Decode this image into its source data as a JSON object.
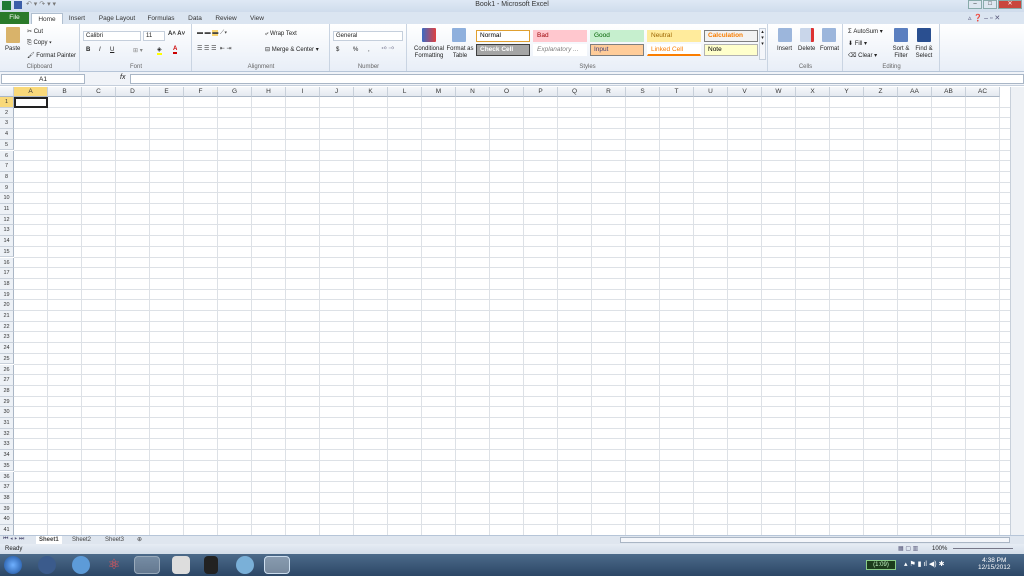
{
  "window": {
    "title": "Book1 - Microsoft Excel"
  },
  "tabs": [
    "File",
    "Home",
    "Insert",
    "Page Layout",
    "Formulas",
    "Data",
    "Review",
    "View"
  ],
  "clipboard": {
    "paste": "Paste",
    "cut": "Cut",
    "copy": "Copy",
    "format_painter": "Format Painter",
    "label": "Clipboard"
  },
  "font": {
    "name": "Calibri",
    "size": "11",
    "bold": "B",
    "italic": "I",
    "underline": "U",
    "label": "Font"
  },
  "alignment": {
    "wrap": "Wrap Text",
    "merge": "Merge & Center",
    "label": "Alignment"
  },
  "number": {
    "format": "General",
    "currency": "$",
    "percent": "%",
    "comma": ",",
    "label": "Number"
  },
  "styles": {
    "conditional": "Conditional Formatting",
    "format_table": "Format as Table",
    "label": "Styles",
    "cells": [
      {
        "name": "Normal",
        "bg": "#ffffff",
        "fg": "#000000",
        "border": "#e0a030"
      },
      {
        "name": "Bad",
        "bg": "#ffc7ce",
        "fg": "#9c0006",
        "border": "#ffc7ce"
      },
      {
        "name": "Good",
        "bg": "#c6efce",
        "fg": "#006100",
        "border": "#c6efce"
      },
      {
        "name": "Neutral",
        "bg": "#ffeb9c",
        "fg": "#9c6500",
        "border": "#ffeb9c"
      },
      {
        "name": "Calculation",
        "bg": "#f2f2f2",
        "fg": "#fa7d00",
        "border": "#7f7f7f"
      },
      {
        "name": "Check Cell",
        "bg": "#a5a5a5",
        "fg": "#ffffff",
        "border": "#3f3f3f"
      },
      {
        "name": "Explanatory ...",
        "bg": "#ffffff",
        "fg": "#7f7f7f",
        "border": "#ffffff"
      },
      {
        "name": "Input",
        "bg": "#ffcc99",
        "fg": "#3f3f76",
        "border": "#7f7f7f"
      },
      {
        "name": "Linked Cell",
        "bg": "#ffffff",
        "fg": "#fa7d00",
        "border": "#ffffff"
      },
      {
        "name": "Note",
        "bg": "#ffffcc",
        "fg": "#000000",
        "border": "#b2b2b2"
      }
    ]
  },
  "cells": {
    "insert": "Insert",
    "delete": "Delete",
    "format": "Format",
    "label": "Cells"
  },
  "editing": {
    "autosum": "AutoSum",
    "fill": "Fill",
    "clear": "Clear",
    "sort": "Sort & Filter",
    "find": "Find & Select",
    "label": "Editing"
  },
  "formula_bar": {
    "name_box": "A1",
    "fx": "fx",
    "value": ""
  },
  "columns": [
    "A",
    "B",
    "C",
    "D",
    "E",
    "F",
    "G",
    "H",
    "I",
    "J",
    "K",
    "L",
    "M",
    "N",
    "O",
    "P",
    "Q",
    "R",
    "S",
    "T",
    "U",
    "V",
    "W",
    "X",
    "Y",
    "Z",
    "AA",
    "AB",
    "AC"
  ],
  "row_count": 41,
  "selected_cell": "A1",
  "sheets": [
    "Sheet1",
    "Sheet2",
    "Sheet3"
  ],
  "active_sheet": "Sheet1",
  "status": {
    "text": "Ready",
    "zoom": "100%"
  },
  "tray": {
    "battery": "(1:09)",
    "time": "4:38 PM",
    "date": "12/15/2012"
  }
}
